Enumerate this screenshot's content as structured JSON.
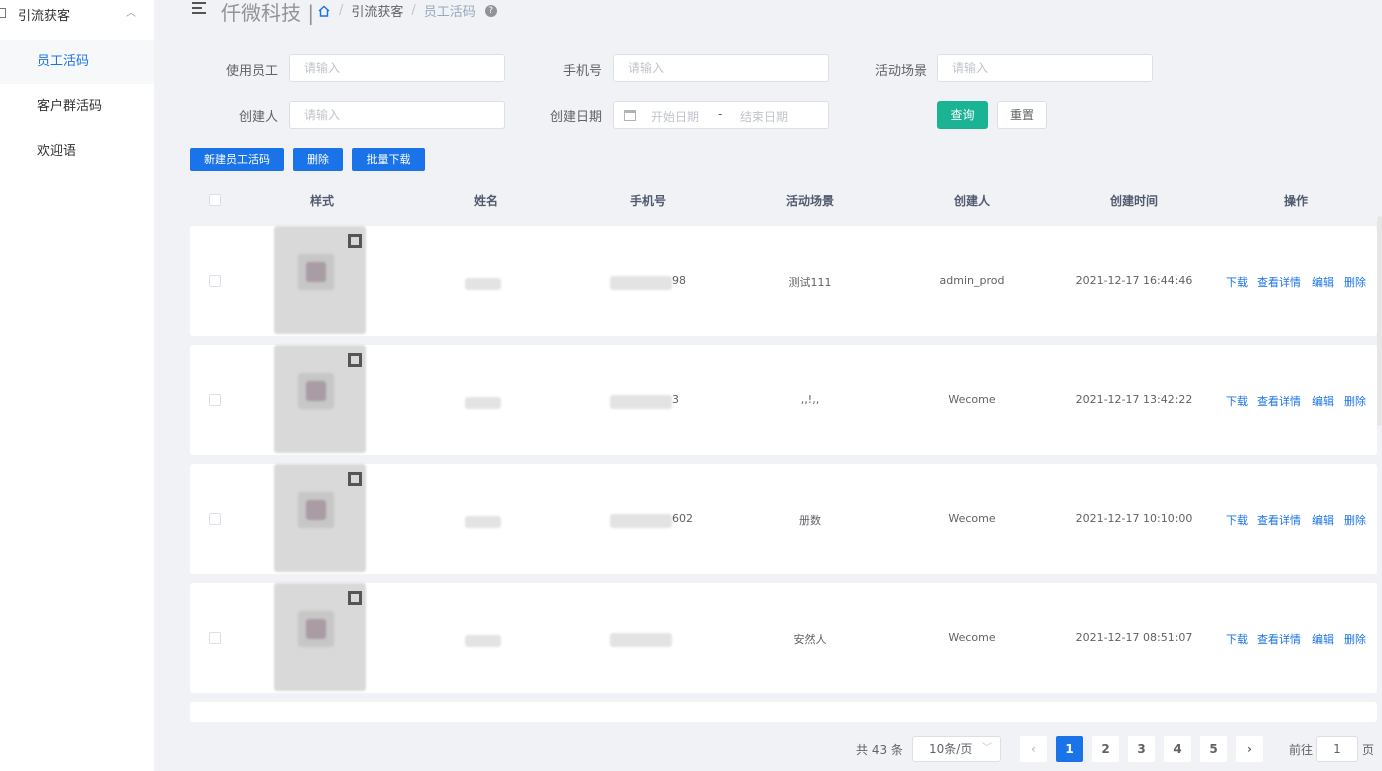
{
  "sidebar": {
    "group_label": "引流获客",
    "items": [
      {
        "label": "员工活码",
        "active": true
      },
      {
        "label": "客户群活码",
        "active": false
      },
      {
        "label": "欢迎语",
        "active": false
      }
    ]
  },
  "header": {
    "brand": "仟微科技 |",
    "breadcrumb": [
      "引流获客",
      "员工活码"
    ]
  },
  "filters": {
    "employee_label": "使用员工",
    "phone_label": "手机号",
    "scene_label": "活动场景",
    "creator_label": "创建人",
    "date_label": "创建日期",
    "placeholder": "请输入",
    "date_start_placeholder": "开始日期",
    "date_sep": "-",
    "date_end_placeholder": "结束日期",
    "search_button": "查询",
    "reset_button": "重置"
  },
  "toolbar": {
    "new_button": "新建员工活码",
    "delete_button": "删除",
    "batch_download_button": "批量下载"
  },
  "table": {
    "columns": [
      "样式",
      "姓名",
      "手机号",
      "活动场景",
      "创建人",
      "创建时间",
      "操作"
    ],
    "rows": [
      {
        "phone_tail": "98",
        "scene": "测试111",
        "creator": "admin_prod",
        "created": "2021-12-17 16:44:46"
      },
      {
        "phone_tail": "3",
        "scene": ",,!,,",
        "creator": "Wecome",
        "created": "2021-12-17 13:42:22"
      },
      {
        "phone_tail": "602",
        "scene": "册数",
        "creator": "Wecome",
        "created": "2021-12-17 10:10:00"
      },
      {
        "phone_tail": "",
        "scene": "安然人",
        "creator": "Wecome",
        "created": "2021-12-17 08:51:07"
      }
    ],
    "actions": [
      "下载",
      "查看详情",
      "编辑",
      "删除"
    ]
  },
  "pagination": {
    "total": "共 43 条",
    "page_size": "10条/页",
    "pages": [
      "1",
      "2",
      "3",
      "4",
      "5"
    ],
    "current": "1",
    "goto_label": "前往",
    "goto_value": "1",
    "goto_unit": "页"
  }
}
